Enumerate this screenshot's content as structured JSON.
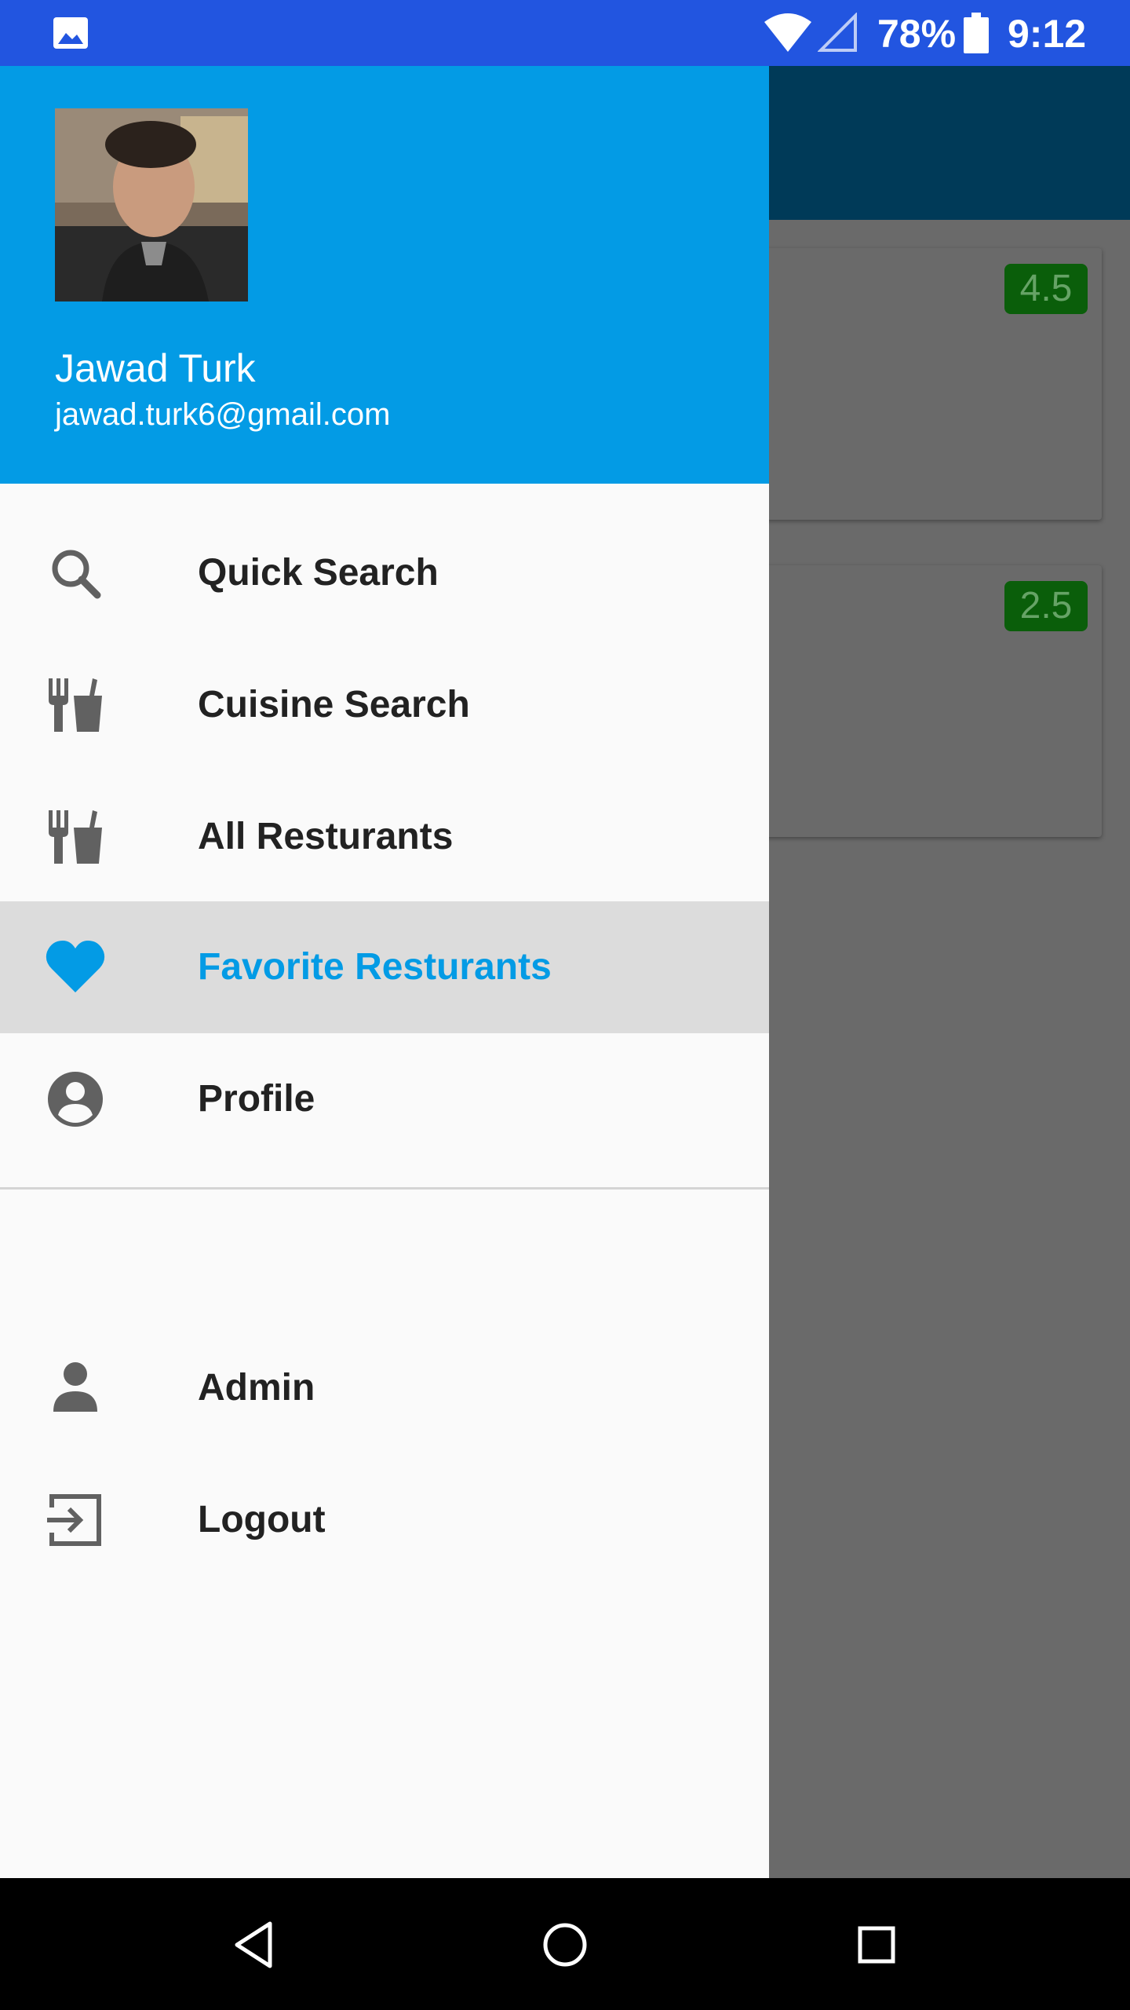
{
  "status_bar": {
    "battery_percent": "78%",
    "time": "9:12",
    "icons": [
      "image-icon",
      "wifi-icon",
      "signal-icon",
      "battery-icon"
    ]
  },
  "background": {
    "cards": [
      {
        "rating": "4.5"
      },
      {
        "rating": "2.5"
      }
    ]
  },
  "drawer": {
    "user": {
      "name": "Jawad Turk",
      "email": "jawad.turk6@gmail.com"
    },
    "items": [
      {
        "label": "Quick Search",
        "icon": "search-icon",
        "active": false
      },
      {
        "label": "Cuisine Search",
        "icon": "restaurant-icon",
        "active": false
      },
      {
        "label": "All Resturants",
        "icon": "restaurant-icon",
        "active": false
      },
      {
        "label": "Favorite Resturants",
        "icon": "heart-icon",
        "active": true
      },
      {
        "label": "Profile",
        "icon": "account-circle-icon",
        "active": false
      },
      {
        "label": "Admin",
        "icon": "person-icon",
        "active": false
      },
      {
        "label": "Logout",
        "icon": "exit-icon",
        "active": false
      }
    ]
  },
  "colors": {
    "status_bar": "#2255e0",
    "drawer_header": "#039be5",
    "active_item": "#039be5",
    "rating_badge": "#0a5e0a"
  },
  "nav_bar": {
    "buttons": [
      "back-icon",
      "home-icon",
      "recents-icon"
    ]
  }
}
